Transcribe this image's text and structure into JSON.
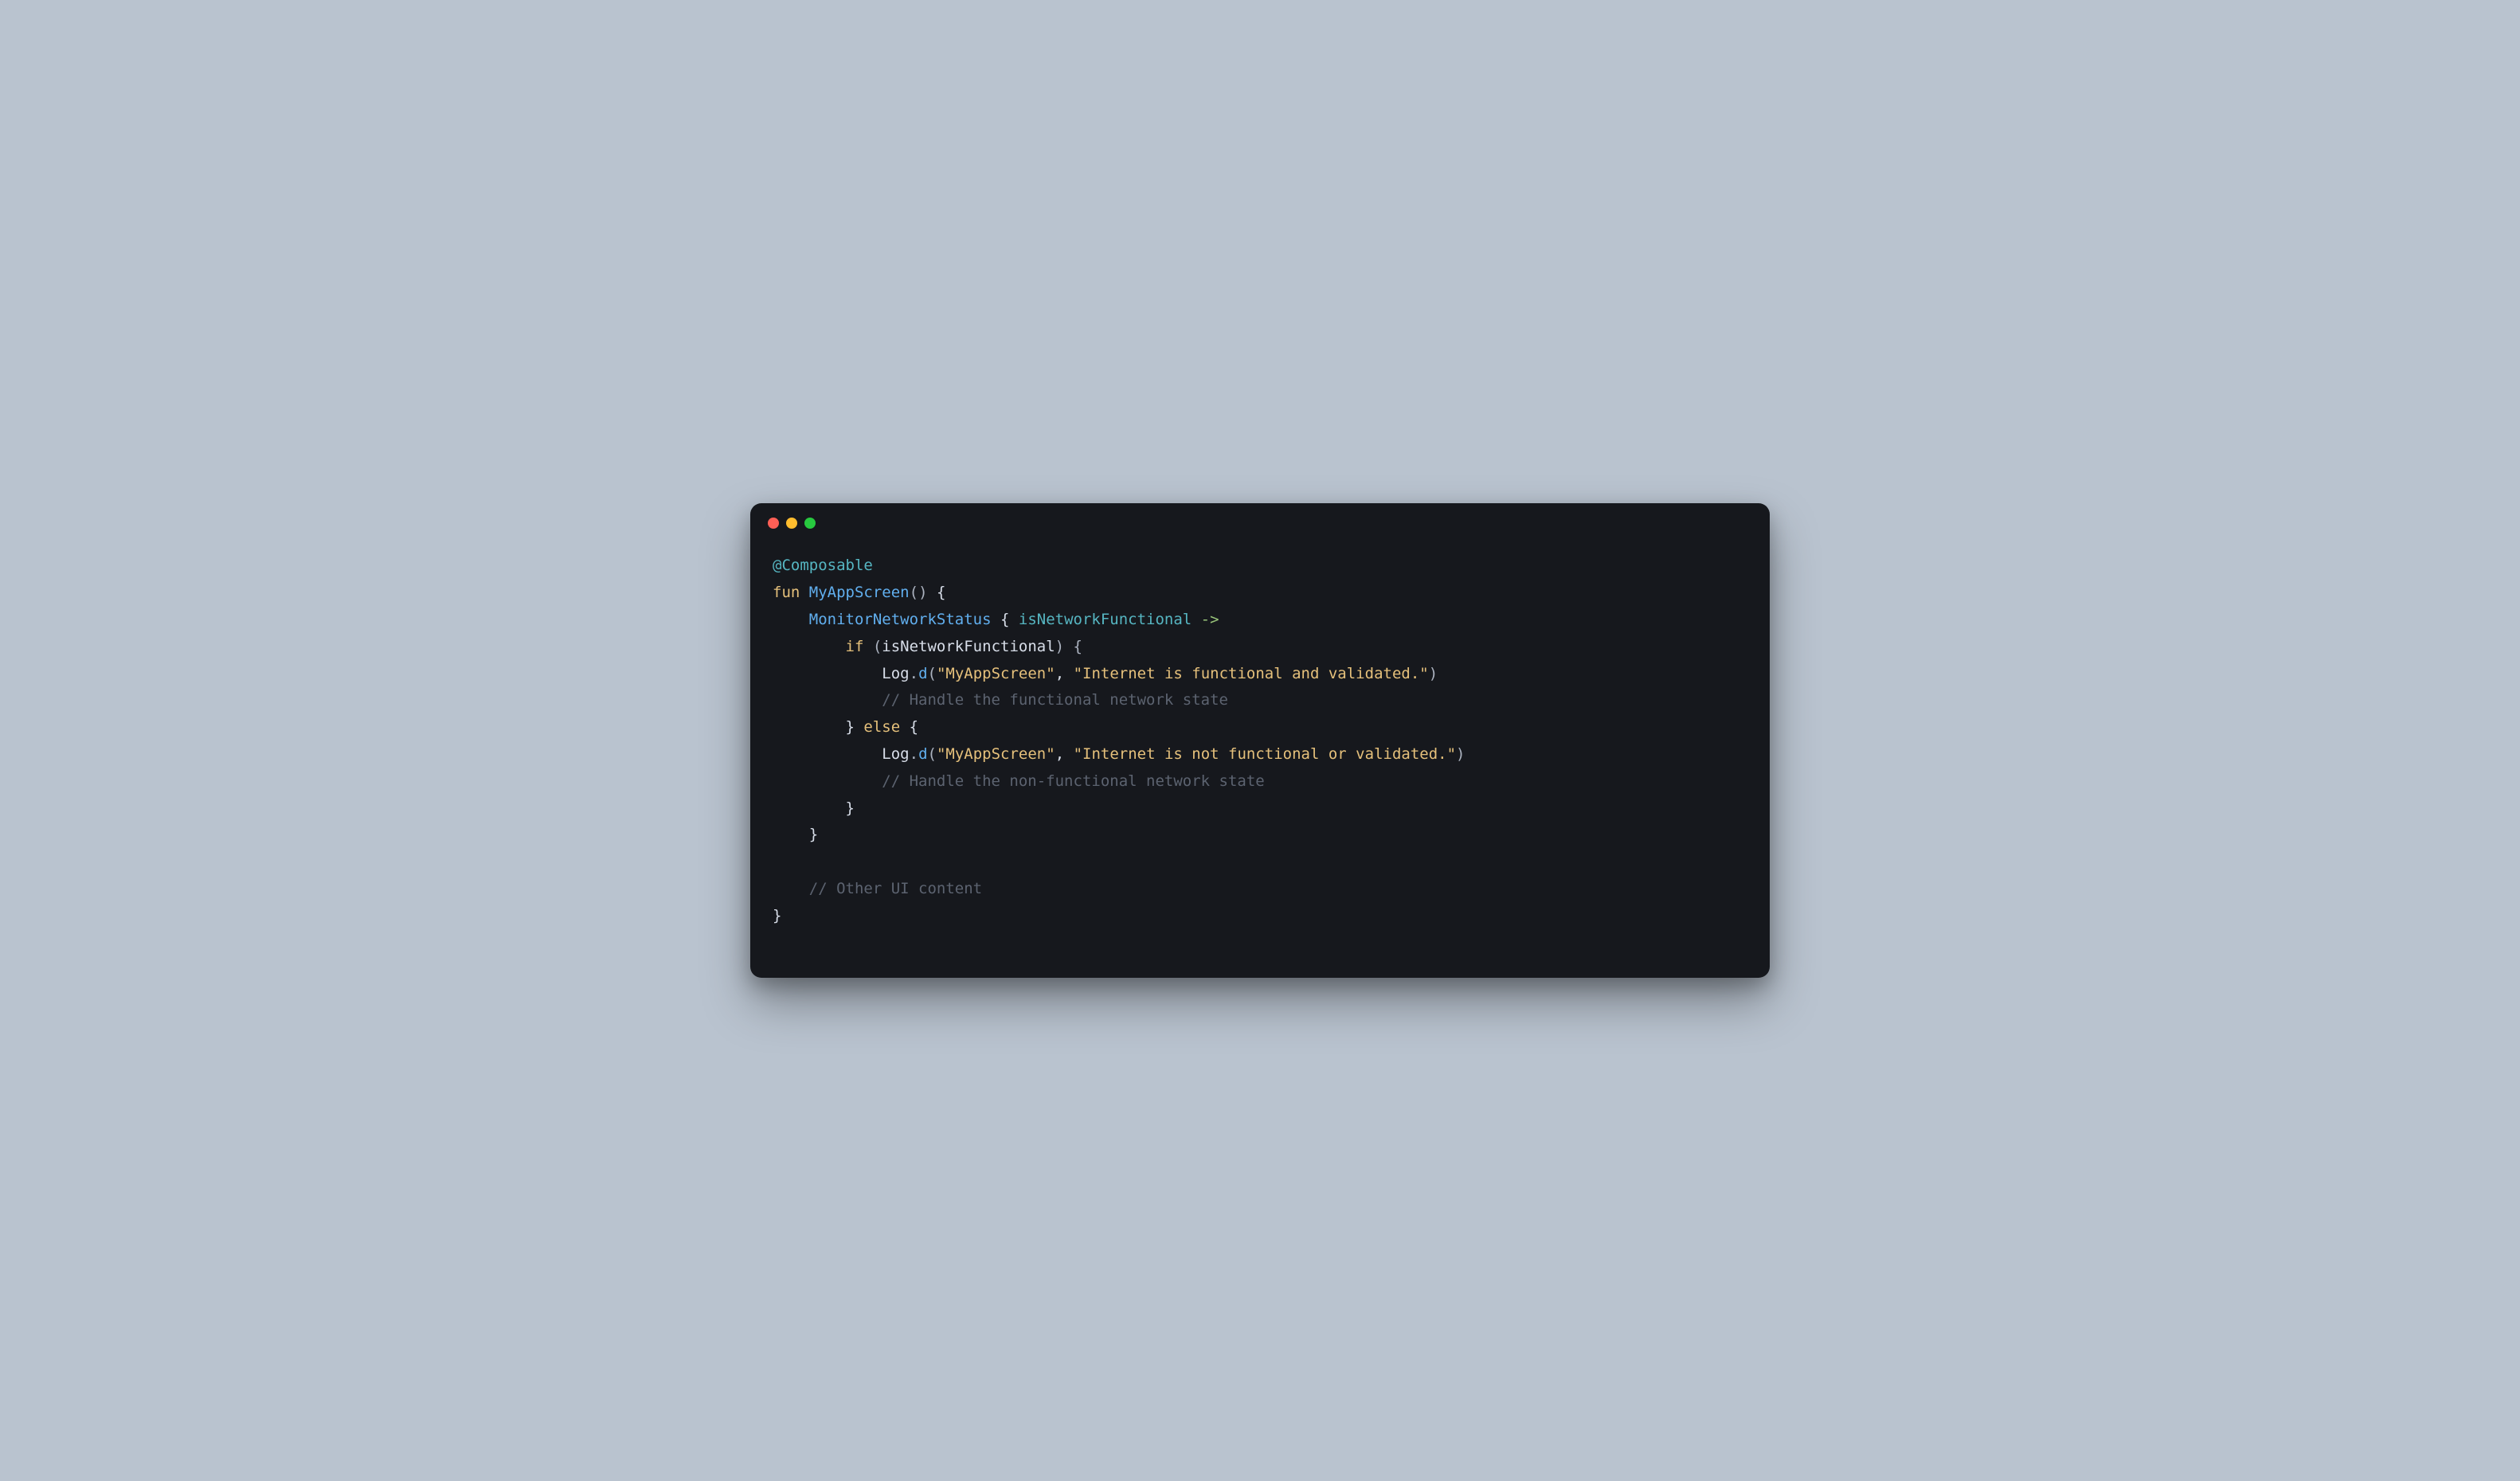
{
  "code": {
    "line01": {
      "annotation": "@Composable"
    },
    "line02": {
      "keyword": "fun",
      "funcName": "MyAppScreen",
      "parens": "()",
      "brace": " {"
    },
    "line03": {
      "indent": "    ",
      "call": "MonitorNetworkStatus",
      "open": " { ",
      "param": "isNetworkFunctional",
      "arrow": " ->"
    },
    "line04": {
      "indent": "        ",
      "keyword": "if",
      "open": " (",
      "cond": "isNetworkFunctional",
      "close": ") {"
    },
    "line05": {
      "indent": "            ",
      "obj": "Log",
      "dot": ".",
      "method": "d",
      "open": "(",
      "str1": "\"MyAppScreen\"",
      "comma": ", ",
      "str2": "\"Internet is functional and validated.\"",
      "close": ")"
    },
    "line06": {
      "indent": "            ",
      "comment": "// Handle the functional network state"
    },
    "line07": {
      "indent": "        ",
      "close": "}",
      "keyword": " else ",
      "open": "{"
    },
    "line08": {
      "indent": "            ",
      "obj": "Log",
      "dot": ".",
      "method": "d",
      "open": "(",
      "str1": "\"MyAppScreen\"",
      "comma": ", ",
      "str2": "\"Internet is not functional or validated.\"",
      "close": ")"
    },
    "line09": {
      "indent": "            ",
      "comment": "// Handle the non-functional network state"
    },
    "line10": {
      "indent": "        ",
      "brace": "}"
    },
    "line11": {
      "indent": "    ",
      "brace": "}"
    },
    "line12": {
      "blank": ""
    },
    "line13": {
      "indent": "    ",
      "comment": "// Other UI content"
    },
    "line14": {
      "brace": "}"
    }
  }
}
